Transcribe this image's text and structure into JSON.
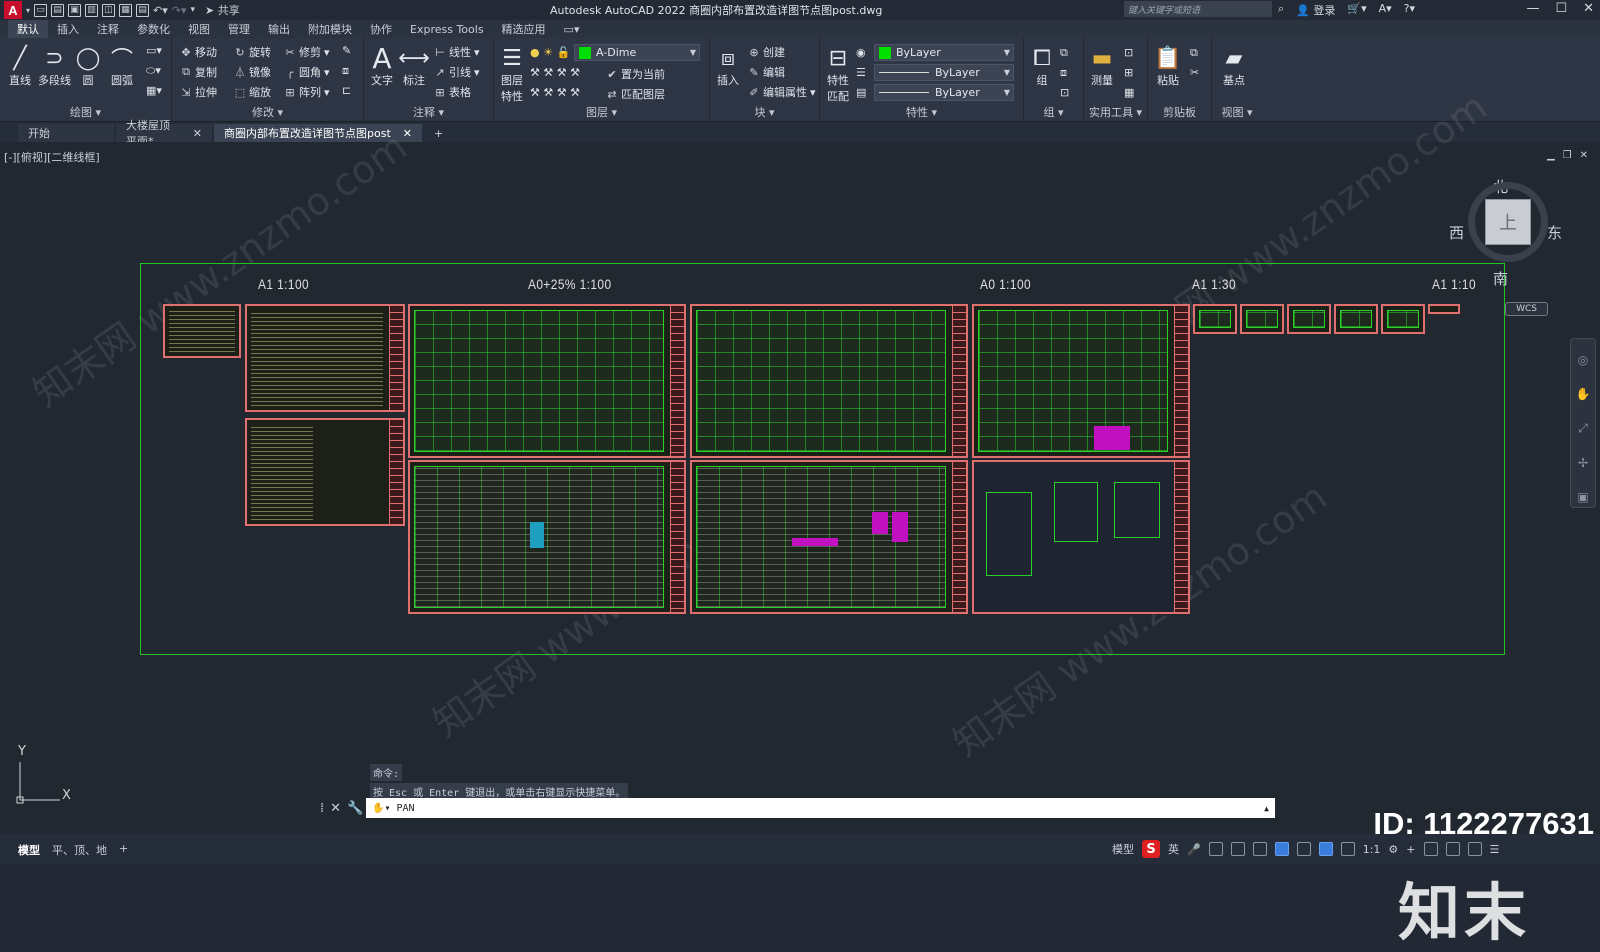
{
  "app": {
    "logo_letter": "A",
    "share_label": "共享",
    "title": "Autodesk AutoCAD 2022    商圈内部布置改造详图节点图post.dwg",
    "search_placeholder": "键入关键字或短语",
    "login_label": "登录"
  },
  "ribbon_tabs": [
    "默认",
    "插入",
    "注释",
    "参数化",
    "视图",
    "管理",
    "输出",
    "附加模块",
    "协作",
    "Express Tools",
    "精选应用"
  ],
  "ribbon": {
    "draw": {
      "title": "绘图",
      "line": "直线",
      "polyline": "多段线",
      "circle": "圆",
      "arc": "圆弧"
    },
    "modify": {
      "title": "修改",
      "move": "移动",
      "rotate": "旋转",
      "trim": "修剪",
      "copy": "复制",
      "mirror": "镜像",
      "fillet": "圆角",
      "stretch": "拉伸",
      "scale": "缩放",
      "array": "阵列"
    },
    "annotation": {
      "title": "注释",
      "text": "文字",
      "dimension": "标注",
      "linear": "线性",
      "leader": "引线",
      "table": "表格"
    },
    "layers": {
      "title": "图层",
      "layer_props": "图层\n特性",
      "current_layer": "A-Dime",
      "set_current": "置为当前",
      "match_layer": "匹配图层"
    },
    "block": {
      "title": "块",
      "insert": "插入",
      "create": "创建",
      "edit": "编辑",
      "edit_attr": "编辑属性"
    },
    "properties": {
      "title": "特性",
      "match": "特性\n匹配",
      "color": "ByLayer",
      "linetype": "ByLayer",
      "lineweight": "ByLayer"
    },
    "groups": {
      "title": "组",
      "group": "组"
    },
    "utilities": {
      "title": "实用工具",
      "measure": "测量"
    },
    "clipboard": {
      "title": "剪贴板",
      "paste": "粘贴"
    },
    "view": {
      "title": "视图",
      "base": "基点"
    }
  },
  "doc_tabs": [
    {
      "label": "开始",
      "closable": false
    },
    {
      "label": "大楼屋顶平面*",
      "closable": true
    },
    {
      "label": "商圈内部布置改造详图节点图post",
      "closable": true
    }
  ],
  "viewport": {
    "label": "[-][俯视][二维线框]",
    "scale_labels": [
      "A1   1:100",
      "A0+25%   1:100",
      "A0   1:100",
      "A1   1:30",
      "A1   1:10"
    ],
    "viewcube": {
      "face": "上",
      "north": "北",
      "south": "南",
      "east": "东",
      "west": "西",
      "wcs": "WCS"
    },
    "ucs_y": "Y",
    "ucs_x": "X"
  },
  "command": {
    "history_1": "命令:",
    "history_2": "按 Esc 或 Enter 键退出，或单击右键显示快捷菜单。",
    "current": "PAN"
  },
  "layout_tabs": [
    "模型",
    "平、顶、地"
  ],
  "status": {
    "model": "模型",
    "ime": "英",
    "scale": "1:1"
  },
  "watermark": {
    "logo": "知末",
    "id": "ID: 1122277631",
    "site": "知末网 www.znzmo.com"
  },
  "colors": {
    "accent": "#3b7ddd",
    "frame_green": "#22c322",
    "sheet_border": "#e07070",
    "bg": "#212830"
  }
}
